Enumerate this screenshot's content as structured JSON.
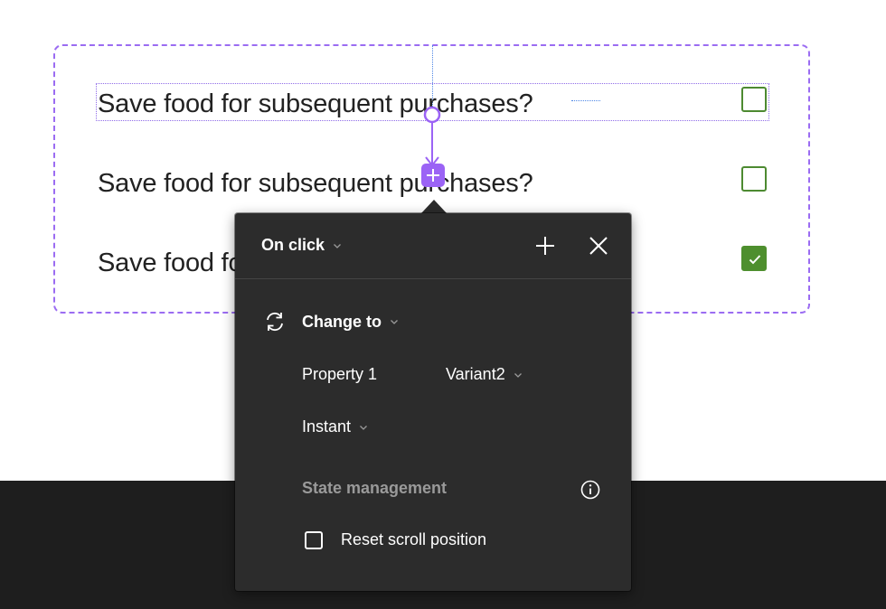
{
  "canvas": {
    "variants": [
      {
        "label": "Save food for subsequent purchases?",
        "checked": false
      },
      {
        "label": "Save food for subsequent purchases?",
        "checked": false
      },
      {
        "label": "Save food for subsequent purchases?",
        "checked": true
      }
    ]
  },
  "interaction_panel": {
    "trigger": "On click",
    "add_icon": "plus-icon",
    "close_icon": "close-icon",
    "action": {
      "icon": "swap-cycle-icon",
      "label": "Change to"
    },
    "property": {
      "name": "Property 1",
      "value": "Variant2"
    },
    "animation": "Instant",
    "state_management": {
      "heading": "State management",
      "info_icon": "info-icon",
      "reset_scroll_label": "Reset scroll position",
      "reset_scroll_checked": false
    }
  },
  "colors": {
    "selection_purple": "#9b6cf2",
    "checkbox_green": "#4e8f2e",
    "panel_bg": "#2c2c2c",
    "canvas_dark": "#1e1e1e",
    "muted_text": "#9a9a9a"
  }
}
